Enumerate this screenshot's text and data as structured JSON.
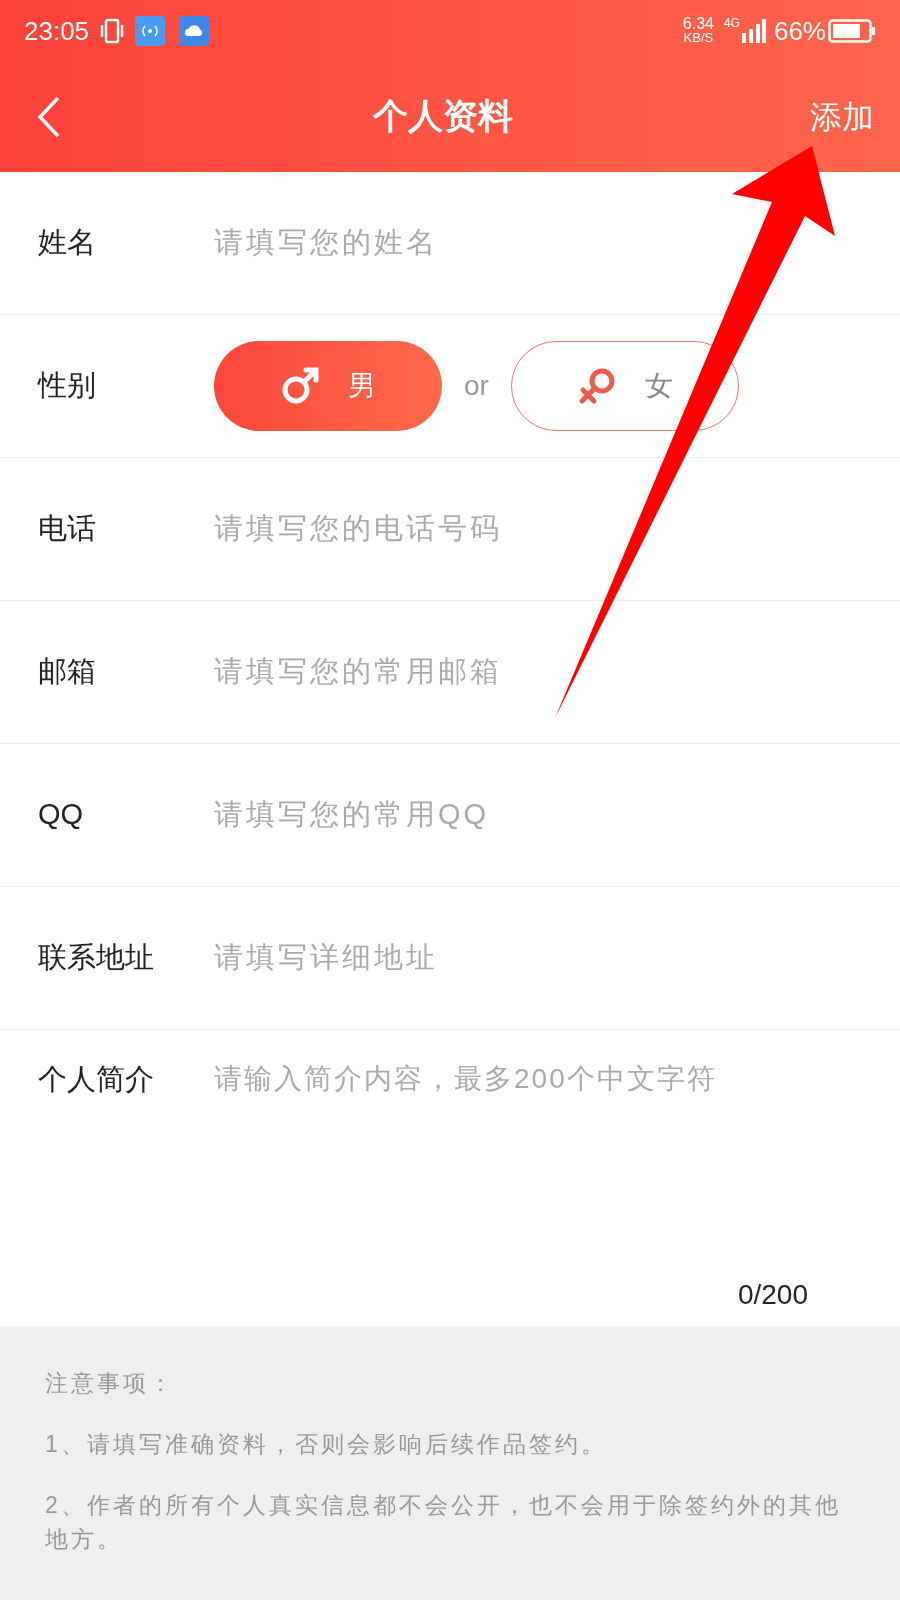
{
  "status_bar": {
    "time": "23:05",
    "speed": "6.34",
    "speed_unit": "KB/S",
    "network": "4G",
    "battery": "66%"
  },
  "header": {
    "title": "个人资料",
    "action": "添加"
  },
  "fields": [
    {
      "kind": "input",
      "label": "姓名",
      "placeholder": "请填写您的姓名"
    },
    {
      "kind": "gender",
      "label": "性别",
      "separator": "or",
      "options": [
        {
          "kind": "male",
          "label": "男",
          "selected": true
        },
        {
          "kind": "female",
          "label": "女",
          "selected": false
        }
      ]
    },
    {
      "kind": "input",
      "label": "电话",
      "placeholder": "请填写您的电话号码"
    },
    {
      "kind": "input",
      "label": "邮箱",
      "placeholder": "请填写您的常用邮箱"
    },
    {
      "kind": "input",
      "label": "QQ",
      "placeholder": "请填写您的常用QQ"
    },
    {
      "kind": "input",
      "label": "联系地址",
      "placeholder": "请填写详细地址"
    },
    {
      "kind": "textarea",
      "label": "个人简介",
      "placeholder": "请输入简介内容，最多200个中文字符",
      "counter": "0/200"
    }
  ],
  "notes": {
    "title": "注意事项：",
    "items": [
      "1、请填写准确资料，否则会影响后续作品签约。",
      "2、作者的所有个人真实信息都不会公开，也不会用于除签约外的其他地方。"
    ]
  }
}
